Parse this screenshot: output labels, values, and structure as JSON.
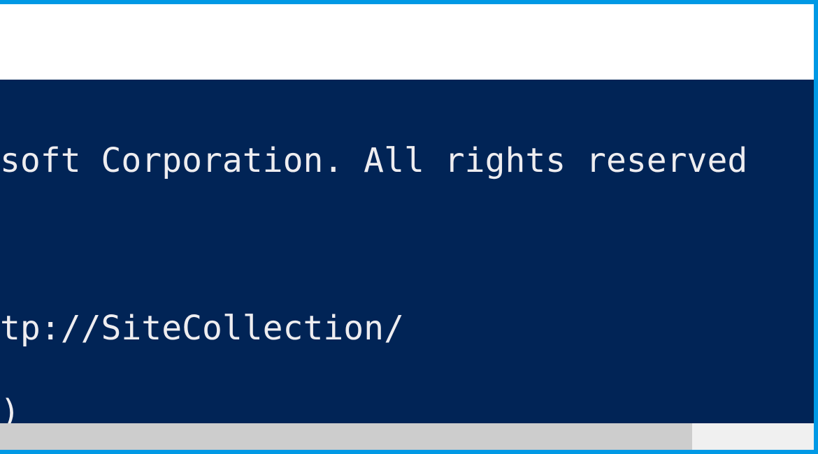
{
  "window": {
    "frame_color": "#0099e5",
    "titlebar_bg": "#ffffff"
  },
  "console": {
    "bg": "#012456",
    "fg": "#eeedf0",
    "lines": {
      "l0": "soft Corporation. All rights reserved",
      "l1": "",
      "l2": "tp://SiteCollection/",
      "l3": ")"
    }
  },
  "scrollbar": {
    "thumb_color": "#cdcdcd",
    "track_color": "#f0f0f0"
  }
}
